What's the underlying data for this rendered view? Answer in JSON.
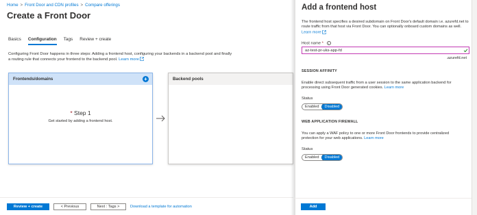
{
  "breadcrumb": {
    "items": [
      "Home",
      "Front Door and CDN profiles",
      "Compare offerings"
    ],
    "separator": ">"
  },
  "page": {
    "title": "Create a Front Door",
    "more": "···"
  },
  "tabs": [
    {
      "label": "Basics",
      "active": false
    },
    {
      "label": "Configuration",
      "active": true
    },
    {
      "label": "Tags",
      "active": false
    },
    {
      "label": "Review + create",
      "active": false
    }
  ],
  "intro": {
    "text": "Configuring Front Door happens in three steps: Adding a frontend host, configuring your backends in a backend pool and finally a routing rule that connects your frontend to the backend pool.",
    "link": "Learn more"
  },
  "frontends_panel": {
    "title": "Frontends/domains",
    "add_icon": "+",
    "step_required": "*",
    "step": "Step 1",
    "description": "Get started by adding a frontend host."
  },
  "backend_panel": {
    "title": "Backend pools"
  },
  "footer": {
    "review_label": "Review + create",
    "previous_label": "< Previous",
    "next_label": "Next : Tags >",
    "template_link": "Download a template for automation"
  },
  "flyout": {
    "title": "Add a frontend host",
    "description": "The frontend host specifies a desired subdomain on Front Door's default domain i.e. azurefd.net to route traffic from that host via Front Door. You can optionally onboard custom domains as well.",
    "description_link": "Learn more",
    "host_name_label": "Host name",
    "host_name_required": "*",
    "host_name_value": "az-test-pr-uks-app-fd",
    "host_suffix": ".azurefd.net",
    "session_affinity": {
      "heading": "SESSION AFFINITY",
      "text": "Enable direct subsequent traffic from a user session to the same application backend for processing using Front Door generated cookies.",
      "link": "Learn more",
      "status_label": "Status",
      "options": [
        "Enabled",
        "Disabled"
      ],
      "selected": "Disabled"
    },
    "waf": {
      "heading": "WEB APPLICATION FIREWALL",
      "text": "You can apply a WAF policy to one or more Front Door frontends to provide centralized protection for your web applications.",
      "link": "Learn more",
      "status_label": "Status",
      "options": [
        "Enabled",
        "Disabled"
      ],
      "selected": "Disabled"
    },
    "add_label": "Add"
  },
  "colors": {
    "accent": "#0078d4",
    "frontend_header": "#cfe2f8",
    "input_border": "#c239b3"
  }
}
